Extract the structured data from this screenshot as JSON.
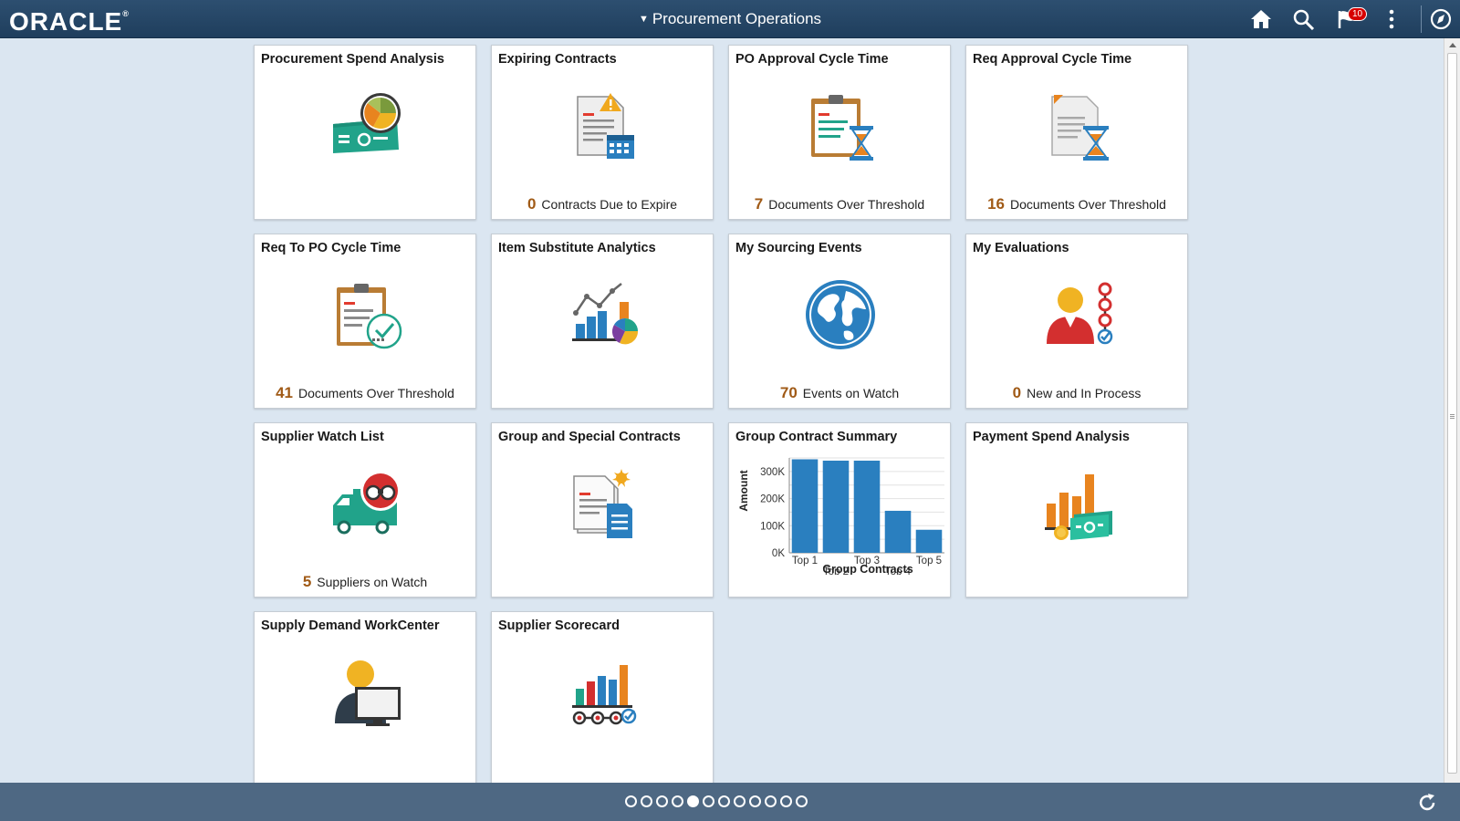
{
  "header": {
    "logo": "ORACLE",
    "logo_mark": "®",
    "title": "Procurement Operations",
    "notification_count": "10",
    "colors": {
      "bar": "#1f3e5d",
      "badge": "#d60000"
    }
  },
  "tiles": [
    {
      "title": "Procurement Spend Analysis",
      "icon": "spend-analysis-icon"
    },
    {
      "title": "Expiring Contracts",
      "icon": "expiring-contracts-icon",
      "count": "0",
      "count_label": "Contracts Due to Expire"
    },
    {
      "title": "PO Approval Cycle Time",
      "icon": "clipboard-hourglass-icon",
      "count": "7",
      "count_label": "Documents Over Threshold"
    },
    {
      "title": "Req Approval Cycle Time",
      "icon": "document-hourglass-icon",
      "count": "16",
      "count_label": "Documents Over Threshold"
    },
    {
      "title": "Req To PO Cycle Time",
      "icon": "clipboard-check-icon",
      "count": "41",
      "count_label": "Documents Over Threshold"
    },
    {
      "title": "Item Substitute Analytics",
      "icon": "analytics-chart-icon"
    },
    {
      "title": "My Sourcing Events",
      "icon": "globe-icon",
      "count": "70",
      "count_label": "Events on Watch"
    },
    {
      "title": "My Evaluations",
      "icon": "person-evaluation-icon",
      "count": "0",
      "count_label": "New and In Process"
    },
    {
      "title": "Supplier Watch List",
      "icon": "truck-binoculars-icon",
      "count": "5",
      "count_label": "Suppliers on Watch"
    },
    {
      "title": "Group and Special Contracts",
      "icon": "contracts-documents-icon"
    },
    {
      "title": "Group Contract Summary",
      "icon": "bar-chart"
    },
    {
      "title": "Payment Spend Analysis",
      "icon": "payment-chart-icon"
    },
    {
      "title": "Supply Demand WorkCenter",
      "icon": "person-computer-icon"
    },
    {
      "title": "Supplier Scorecard",
      "icon": "scorecard-icon"
    }
  ],
  "chart_data": {
    "type": "bar",
    "categories": [
      "Top 1",
      "Top 2",
      "Top 3",
      "Top 4",
      "Top 5"
    ],
    "values": [
      345000,
      340000,
      340000,
      155000,
      85000
    ],
    "xlabel": "Group Contracts",
    "ylabel": "Amount",
    "yticks": [
      "0K",
      "100K",
      "200K",
      "300K"
    ],
    "ylim": [
      0,
      350000
    ],
    "grid": true,
    "bar_color": "#2a7fbf"
  },
  "footer": {
    "page_count": 12,
    "active_page": 5
  }
}
